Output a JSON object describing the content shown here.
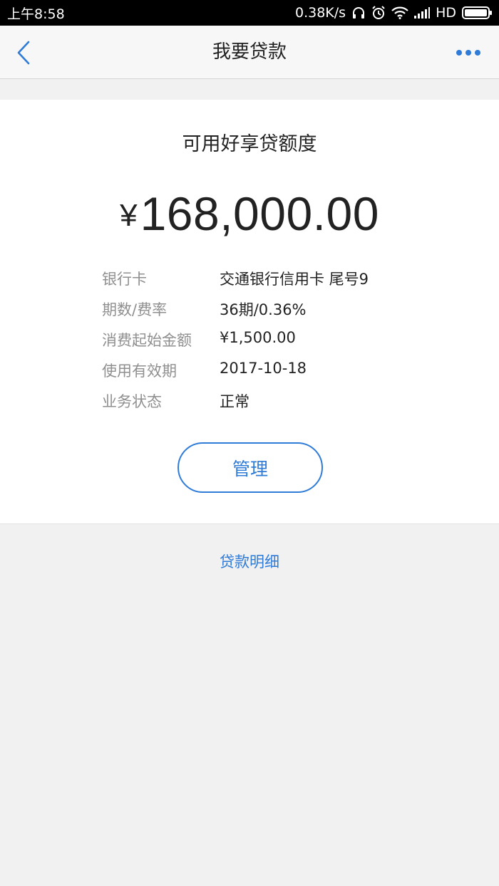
{
  "status_bar": {
    "time": "上午8:58",
    "network_speed": "0.38K/s",
    "network_type": "HD",
    "icons": [
      "headphone-icon",
      "alarm-icon",
      "wifi-icon",
      "signal-icon",
      "battery-icon"
    ]
  },
  "nav": {
    "title": "我要贷款",
    "back_icon": "chevron-left-icon",
    "more_icon": "more-dots-icon",
    "accent_color": "#2f7bd8"
  },
  "card": {
    "title": "可用好享贷额度",
    "currency_symbol": "¥",
    "amount": "168,000.00",
    "rows": [
      {
        "label": "银行卡",
        "value": "交通银行信用卡 尾号9"
      },
      {
        "label": "期数/费率",
        "value": "36期/0.36%"
      },
      {
        "label": "消费起始金额",
        "value": "¥1,500.00"
      },
      {
        "label": "使用有效期",
        "value": "2017-10-18"
      },
      {
        "label": "业务状态",
        "value": "正常"
      }
    ],
    "manage_button": "管理"
  },
  "detail_link": "贷款明细"
}
